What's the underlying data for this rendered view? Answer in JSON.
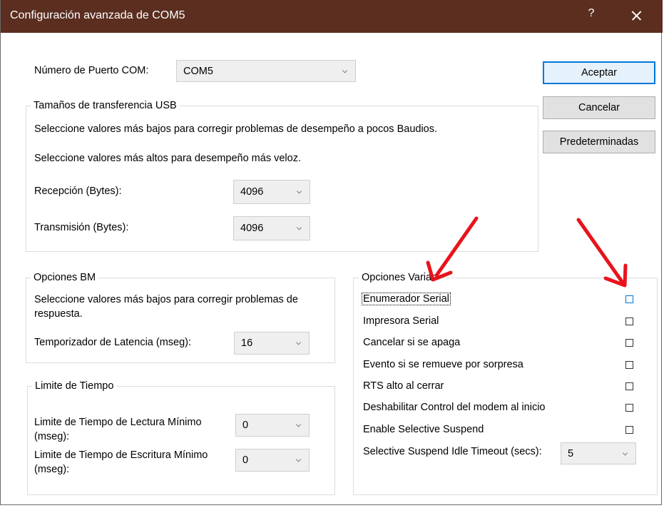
{
  "window": {
    "title": "Configuración avanzada de COM5",
    "help_label": "?"
  },
  "com_port": {
    "label": "Número de Puerto COM:",
    "value": "COM5"
  },
  "buttons": {
    "accept": "Aceptar",
    "cancel": "Cancelar",
    "defaults": "Predeterminadas"
  },
  "usb_transfer": {
    "title": "Tamaños de transferencia USB",
    "hint_low": "Seleccione valores más bajos para corregir problemas de desempeño a pocos Baudios.",
    "hint_high": "Seleccione valores más altos para desempeño más veloz.",
    "receive_label": "Recepción (Bytes):",
    "receive_value": "4096",
    "transmit_label": "Transmisión (Bytes):",
    "transmit_value": "4096"
  },
  "bm_options": {
    "title": "Opciones BM",
    "hint": "Seleccione valores más bajos para corregir problemas de respuesta.",
    "latency_label": "Temporizador de Latencia (mseg):",
    "latency_value": "16"
  },
  "timeouts": {
    "title": "Limite de Tiempo",
    "read_label": "Limite de Tiempo de Lectura Mínimo (mseg):",
    "read_value": "0",
    "write_label": "Limite de Tiempo de Escritura Mínimo (mseg):",
    "write_value": "0"
  },
  "misc_options": {
    "title": "Opciones Varias",
    "items": [
      {
        "label": "Enumerador Serial",
        "checked": false
      },
      {
        "label": "Impresora Serial",
        "checked": false
      },
      {
        "label": "Cancelar si se apaga",
        "checked": false
      },
      {
        "label": "Evento si se remueve por sorpresa",
        "checked": false
      },
      {
        "label": "RTS alto al cerrar",
        "checked": false
      },
      {
        "label": "Deshabilitar Control del modem al inicio",
        "checked": false
      },
      {
        "label": "Enable Selective Suspend",
        "checked": false
      }
    ],
    "idle_timeout_label": "Selective Suspend Idle Timeout (secs):",
    "idle_timeout_value": "5"
  },
  "colors": {
    "titlebar": "#5b2e20",
    "accent": "#0078d7",
    "annotation_arrow": "#e8131b"
  }
}
